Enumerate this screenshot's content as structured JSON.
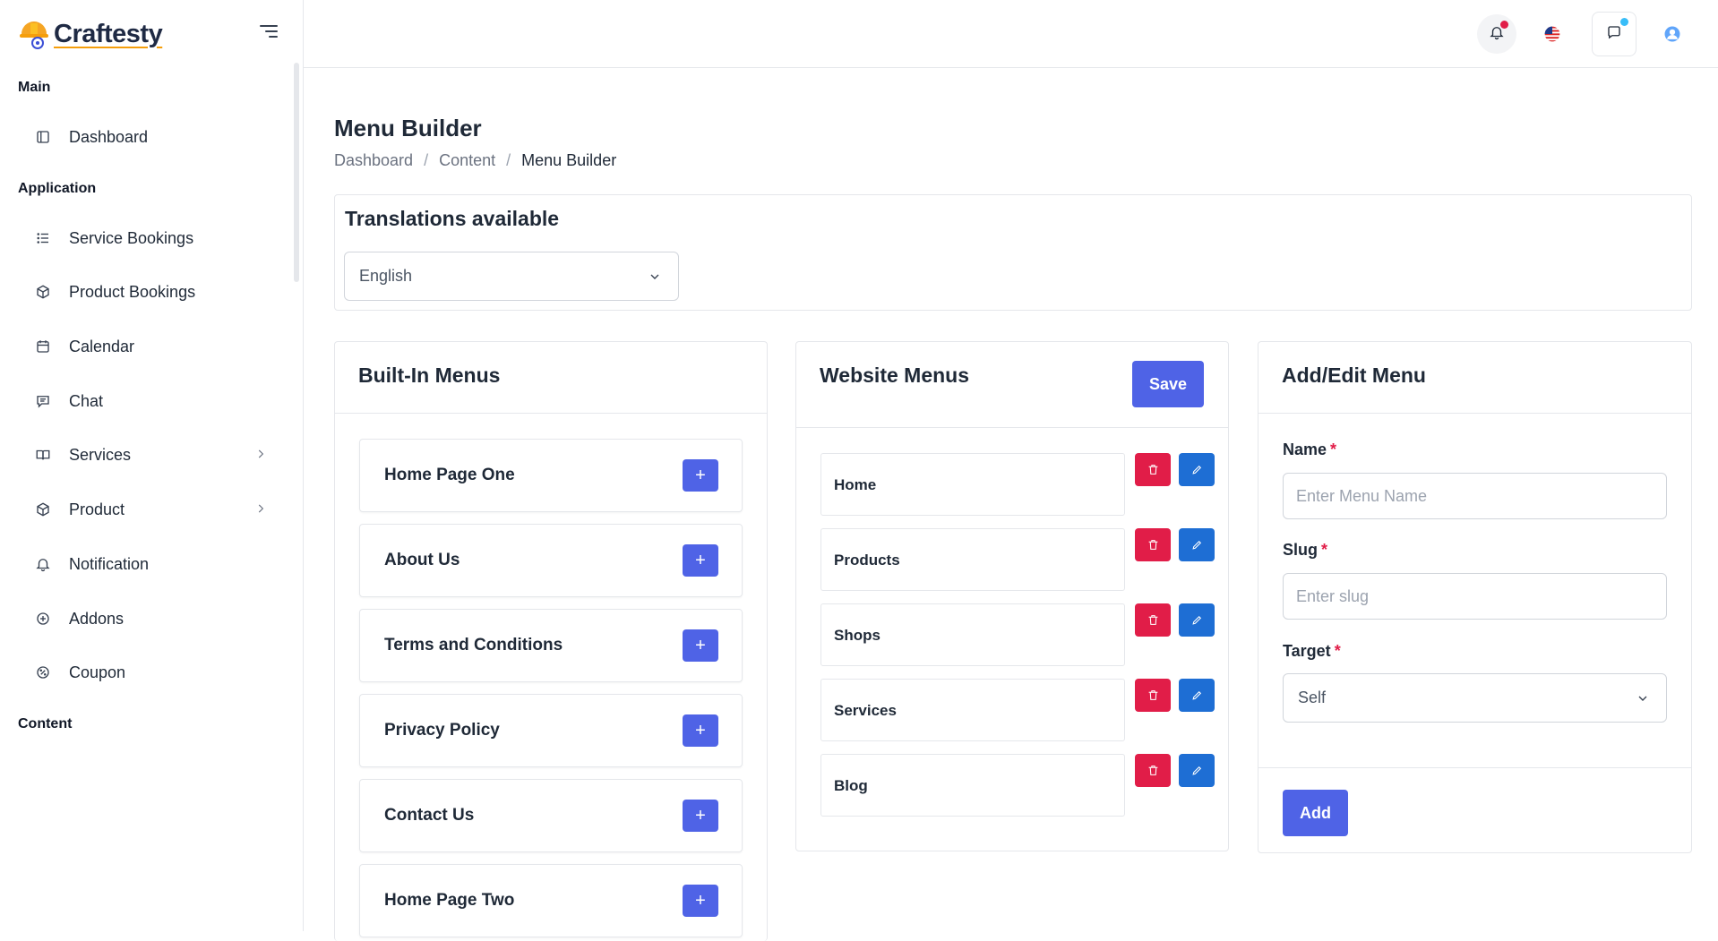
{
  "app": {
    "name": "Craftesty"
  },
  "sidebar": {
    "sections": {
      "main": "Main",
      "application": "Application",
      "content": "Content"
    },
    "items": [
      {
        "label": "Dashboard",
        "icon": "layout-icon"
      },
      {
        "label": "Service Bookings",
        "icon": "list-icon"
      },
      {
        "label": "Product Bookings",
        "icon": "box-icon"
      },
      {
        "label": "Calendar",
        "icon": "calendar-icon"
      },
      {
        "label": "Chat",
        "icon": "chat-icon"
      },
      {
        "label": "Services",
        "icon": "book-icon",
        "expandable": true
      },
      {
        "label": "Product",
        "icon": "box-icon",
        "expandable": true
      },
      {
        "label": "Notification",
        "icon": "bell-icon"
      },
      {
        "label": "Addons",
        "icon": "plus-circle-icon"
      },
      {
        "label": "Coupon",
        "icon": "percent-icon"
      }
    ]
  },
  "topbar": {
    "notification_dot_color": "#e11d48",
    "chat_dot_color": "#38bdf8"
  },
  "page": {
    "title": "Menu Builder",
    "breadcrumb": [
      "Dashboard",
      "Content",
      "Menu Builder"
    ]
  },
  "translations": {
    "title": "Translations available",
    "selected_language": "English"
  },
  "builtin": {
    "title": "Built-In Menus",
    "items": [
      "Home Page One",
      "About Us",
      "Terms and Conditions",
      "Privacy Policy",
      "Contact Us",
      "Home Page Two"
    ],
    "add_symbol": "+"
  },
  "website": {
    "title": "Website Menus",
    "save_label": "Save",
    "items": [
      "Home",
      "Products",
      "Shops",
      "Services",
      "Blog"
    ]
  },
  "form": {
    "title": "Add/Edit Menu",
    "name_label": "Name",
    "name_placeholder": "Enter Menu Name",
    "slug_label": "Slug",
    "slug_placeholder": "Enter slug",
    "target_label": "Target",
    "target_value": "Self",
    "required_mark": "*",
    "add_label": "Add"
  },
  "colors": {
    "primary": "#4f63e6",
    "danger": "#e11d48",
    "edit": "#1e6ed4"
  }
}
